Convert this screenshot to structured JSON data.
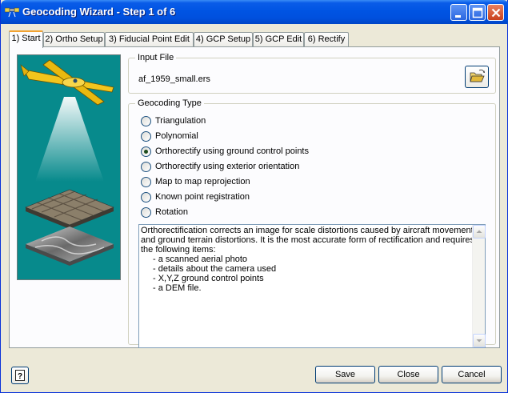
{
  "window": {
    "title": "Geocoding Wizard - Step 1 of 6"
  },
  "tabs": [
    {
      "label": "1) Start",
      "active": true
    },
    {
      "label": "2) Ortho Setup",
      "active": false
    },
    {
      "label": "3) Fiducial Point Edit",
      "active": false
    },
    {
      "label": "4) GCP Setup",
      "active": false
    },
    {
      "label": "5) GCP Edit",
      "active": false
    },
    {
      "label": "6) Rectify",
      "active": false
    }
  ],
  "input_file": {
    "group_label": "Input File",
    "file_name": "af_1959_small.ers"
  },
  "geocoding_type": {
    "group_label": "Geocoding Type",
    "options": [
      {
        "label": "Triangulation",
        "checked": false
      },
      {
        "label": "Polynomial",
        "checked": false
      },
      {
        "label": "Orthorectify using ground control points",
        "checked": true
      },
      {
        "label": "Orthorectify using exterior orientation",
        "checked": false
      },
      {
        "label": "Map to map reprojection",
        "checked": false
      },
      {
        "label": "Known point registration",
        "checked": false
      },
      {
        "label": "Rotation",
        "checked": false
      }
    ],
    "description": {
      "lines": [
        "Orthorectification corrects an image for scale distortions caused by aircraft movement",
        "and ground terrain distortions. It is the most accurate form of rectification and requires",
        "the following items:"
      ],
      "items": [
        "- a scanned aerial photo",
        "- details about the camera used",
        "- X,Y,Z ground control points",
        "- a DEM file."
      ]
    }
  },
  "buttons": {
    "save": "Save",
    "close": "Close",
    "cancel": "Cancel"
  },
  "icons": {
    "app": "satellite-icon",
    "browse": "open-folder-icon",
    "help": "help-icon"
  },
  "colors": {
    "titlebar": "#0054e3",
    "art_background": "#078a8c",
    "active_tab_highlight": "#f3a230"
  }
}
